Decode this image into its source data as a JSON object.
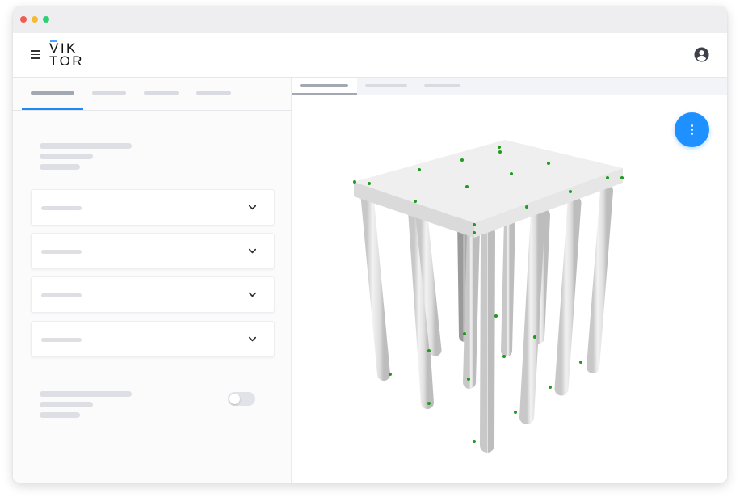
{
  "window": {
    "controls": [
      {
        "name": "close",
        "color": "#f25a53"
      },
      {
        "name": "minimize",
        "color": "#f7bb2e"
      },
      {
        "name": "maximize",
        "color": "#2fcf74"
      }
    ]
  },
  "header": {
    "menu_icon": "hamburger-icon",
    "logo": {
      "line1": "VIK",
      "line2": "TOR",
      "accent": "#4aa3ff"
    },
    "user_icon": "user-circle-icon"
  },
  "editor": {
    "tabs": [
      "",
      "",
      "",
      ""
    ],
    "active_tab": 0,
    "accent": "#1e8af5",
    "sections": [
      {
        "label": "",
        "expand_icon": "chevron-down-icon"
      },
      {
        "label": "",
        "expand_icon": "chevron-down-icon"
      },
      {
        "label": "",
        "expand_icon": "chevron-down-icon"
      },
      {
        "label": "",
        "expand_icon": "chevron-down-icon"
      }
    ],
    "toggle": {
      "state": "off"
    }
  },
  "viewer": {
    "tabs": [
      "",
      "",
      ""
    ],
    "active_tab": 0,
    "action_button": {
      "icon": "more-vertical-icon",
      "color": "#1e90ff"
    },
    "model": {
      "type": "pile foundation",
      "cap_color": "#ececec",
      "pile_color": "#e0e0e0",
      "node_color": "#1f9a1f"
    }
  }
}
